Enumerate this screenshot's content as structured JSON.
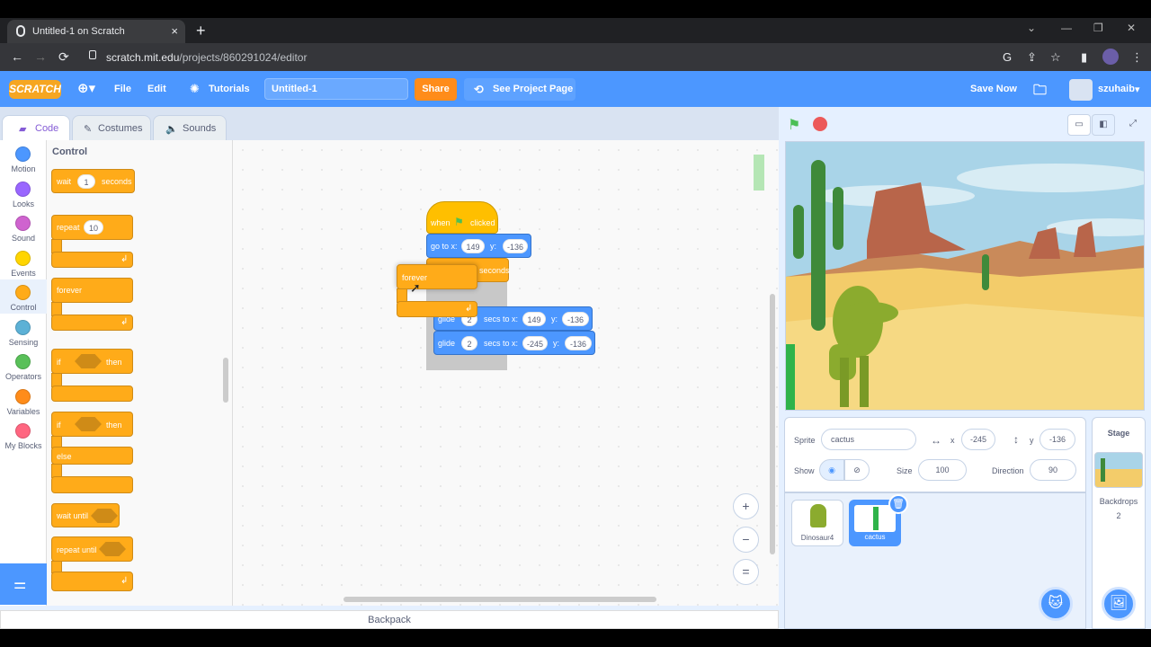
{
  "browser": {
    "tab_title": "Untitled-1 on Scratch",
    "tab_close": "×",
    "new_tab": "+",
    "url_domain": "scratch.mit.edu",
    "url_path": "/projects/860291024/editor",
    "win_min": "—",
    "win_max": "❐",
    "win_close": "✕",
    "back": "←",
    "forward": "→",
    "reload": "⟳"
  },
  "menu": {
    "logo": "SCRATCH",
    "file": "File",
    "edit": "Edit",
    "tutorials": "Tutorials",
    "project_title": "Untitled-1",
    "share": "Share",
    "see_project_page": "See Project Page",
    "save_now": "Save Now",
    "username": "szuhaib"
  },
  "editor_tabs": {
    "code": "Code",
    "costumes": "Costumes",
    "sounds": "Sounds"
  },
  "categories": [
    {
      "label": "Motion",
      "color": "#4c97ff"
    },
    {
      "label": "Looks",
      "color": "#9966ff"
    },
    {
      "label": "Sound",
      "color": "#cf63cf"
    },
    {
      "label": "Events",
      "color": "#ffd500"
    },
    {
      "label": "Control",
      "color": "#ffab19"
    },
    {
      "label": "Sensing",
      "color": "#5cb1d6"
    },
    {
      "label": "Operators",
      "color": "#59c059"
    },
    {
      "label": "Variables",
      "color": "#ff8c1a"
    },
    {
      "label": "My Blocks",
      "color": "#ff6680"
    }
  ],
  "palette": {
    "title": "Control",
    "wait": "wait",
    "wait_val": "1",
    "seconds": "seconds",
    "repeat": "repeat",
    "repeat_val": "10",
    "forever": "forever",
    "if": "if",
    "then": "then",
    "if2": "if",
    "then2": "then",
    "else": "else",
    "wait_until": "wait until",
    "repeat_until": "repeat until"
  },
  "script": {
    "when": "when",
    "clicked": "clicked",
    "goto": "go to x:",
    "goto_x": "149",
    "y_lbl": "y:",
    "goto_y": "-136",
    "hidden_seconds": "seconds",
    "drag_forever": "forever",
    "glide1": "glide",
    "glide1_secs": "2",
    "secs_to_x": "secs to x:",
    "glide1_x": "149",
    "glide1_y": "-136",
    "glide2": "glide",
    "glide2_secs": "2",
    "glide2_x": "-245",
    "glide2_y": "-136"
  },
  "zoom": {
    "in": "+",
    "out": "−",
    "reset": "="
  },
  "backpack": "Backpack",
  "sprite_info": {
    "sprite_label": "Sprite",
    "sprite_name": "cactus",
    "x_label": "x",
    "x": "-245",
    "y_label": "y",
    "y": "-136",
    "show_label": "Show",
    "size_label": "Size",
    "size": "100",
    "direction_label": "Direction",
    "direction": "90"
  },
  "sprites": [
    {
      "name": "Dinosaur4",
      "selected": false
    },
    {
      "name": "cactus",
      "selected": true
    }
  ],
  "stage_panel": {
    "title": "Stage",
    "backdrops_label": "Backdrops",
    "backdrops_count": "2"
  }
}
